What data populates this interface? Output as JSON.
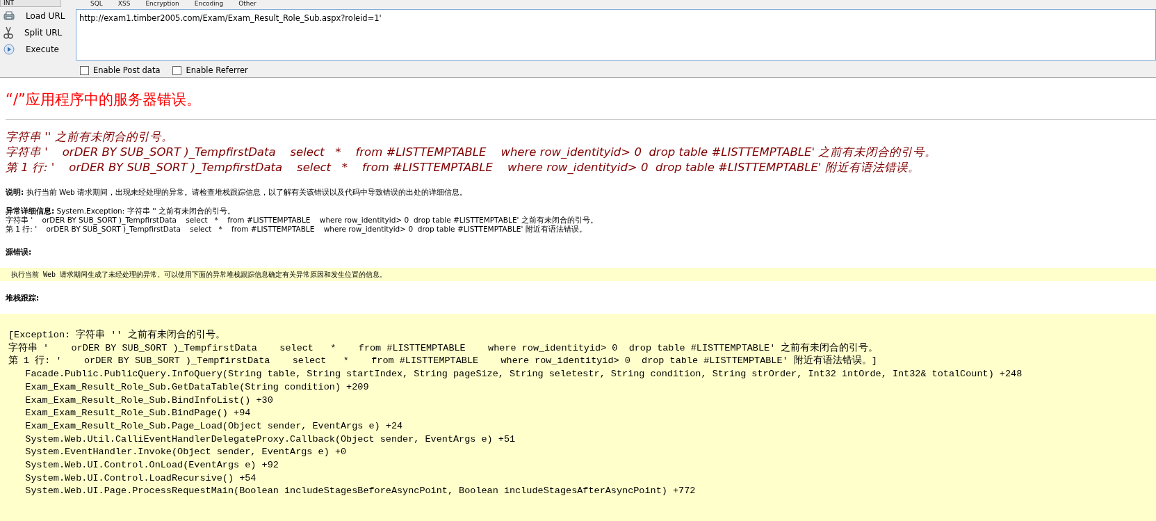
{
  "hackbar": {
    "dropdown": "INT",
    "menu": [
      "SQL",
      "XSS",
      "Encryption",
      "Encoding",
      "Other"
    ],
    "actions": [
      {
        "label": "Load URL",
        "kind": "load"
      },
      {
        "label": "Split URL",
        "kind": "split"
      },
      {
        "label": "Execute",
        "kind": "execute"
      }
    ],
    "url": "http://exam1.timber2005.com/Exam/Exam_Result_Role_Sub.aspx?roleid=1'",
    "checkboxes": [
      {
        "label": "Enable Post data",
        "checked": false
      },
      {
        "label": "Enable Referrer",
        "checked": false
      }
    ]
  },
  "page": {
    "title": "“/”应用程序中的服务器错误。",
    "error_lines": [
      "字符串 '' 之前有未闭合的引号。",
      "字符串 '    orDER BY SUB_SORT )_TempfirstData    select   *    from #LISTTEMPTABLE    where row_identityid> 0  drop table #LISTTEMPTABLE' 之前有未闭合的引号。",
      "第 1 行: '    orDER BY SUB_SORT )_TempfirstData    select   *    from #LISTTEMPTABLE    where row_identityid> 0  drop table #LISTTEMPTABLE' 附近有语法错误。"
    ],
    "description": {
      "label": "说明:",
      "text": "执行当前 Web 请求期间，出现未经处理的异常。请检查堆栈跟踪信息，以了解有关该错误以及代码中导致错误的出处的详细信息。"
    },
    "exception": {
      "label": "异常详细信息:",
      "text": "System.Exception: 字符串 '' 之前有未闭合的引号。",
      "lines": [
        "字符串 '    orDER BY SUB_SORT )_TempfirstData    select   *    from #LISTTEMPTABLE    where row_identityid> 0  drop table #LISTTEMPTABLE' 之前有未闭合的引号。",
        "第 1 行: '    orDER BY SUB_SORT )_TempfirstData    select   *    from #LISTTEMPTABLE    where row_identityid> 0  drop table #LISTTEMPTABLE' 附近有语法错误。"
      ]
    },
    "source_error": {
      "label": "源错误:",
      "text": "执行当前 Web 请求期间生成了未经处理的异常。可以使用下面的异常堆栈跟踪信息确定有关异常原因和发生位置的信息。"
    },
    "stack_trace": {
      "label": "堆栈跟踪:",
      "lines": [
        "[Exception: 字符串 '' 之前有未闭合的引号。",
        "字符串 '    orDER BY SUB_SORT )_TempfirstData    select   *    from #LISTTEMPTABLE    where row_identityid> 0  drop table #LISTTEMPTABLE' 之前有未闭合的引号。",
        "第 1 行: '    orDER BY SUB_SORT )_TempfirstData    select   *    from #LISTTEMPTABLE    where row_identityid> 0  drop table #LISTTEMPTABLE' 附近有语法错误。]",
        "   Facade.Public.PublicQuery.InfoQuery(String table, String startIndex, String pageSize, String seletestr, String condition, String strOrder, Int32 intOrde, Int32& totalCount) +248",
        "   Exam_Exam_Result_Role_Sub.GetDataTable(String condition) +209",
        "   Exam_Exam_Result_Role_Sub.BindInfoList() +30",
        "   Exam_Exam_Result_Role_Sub.BindPage() +94",
        "   Exam_Exam_Result_Role_Sub.Page_Load(Object sender, EventArgs e) +24",
        "   System.Web.Util.CalliEventHandlerDelegateProxy.Callback(Object sender, EventArgs e) +51",
        "   System.EventHandler.Invoke(Object sender, EventArgs e) +0",
        "   System.Web.UI.Control.OnLoad(EventArgs e) +92",
        "   System.Web.UI.Control.LoadRecursive() +54",
        "   System.Web.UI.Page.ProcessRequestMain(Boolean includeStagesBeforeAsyncPoint, Boolean includeStagesAfterAsyncPoint) +772"
      ]
    }
  }
}
